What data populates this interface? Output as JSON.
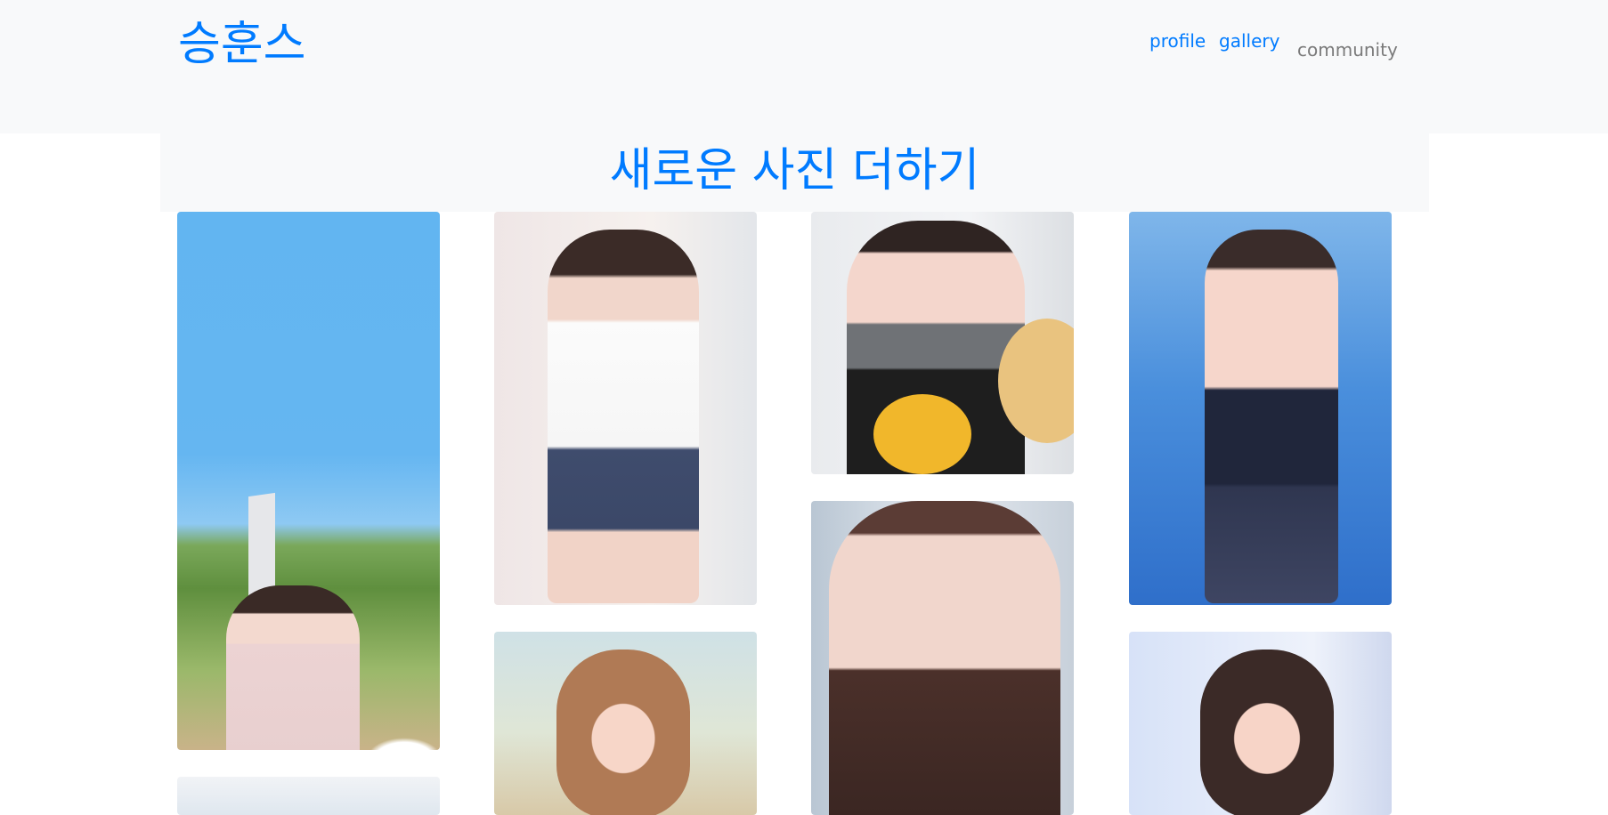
{
  "navbar": {
    "brand": "승훈스",
    "links": [
      "profile",
      "gallery",
      "community"
    ]
  },
  "hero": {
    "title": "새로운 사진 더하기"
  },
  "gallery": {
    "photos": [
      {
        "id": "photo-1",
        "description": "photo"
      },
      {
        "id": "photo-2",
        "description": "photo"
      },
      {
        "id": "photo-3",
        "description": "photo"
      },
      {
        "id": "photo-4",
        "description": "photo"
      }
    ]
  },
  "colors": {
    "brand": "#007bff",
    "muted_link": "#7a7a7a",
    "surface": "#f8f9fa"
  }
}
